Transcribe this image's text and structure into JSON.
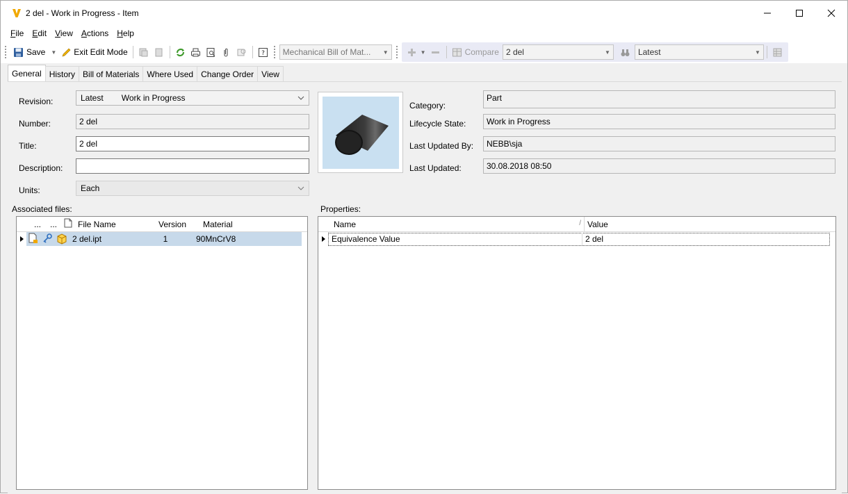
{
  "window": {
    "title": "2 del - Work in Progress - Item"
  },
  "menu": [
    {
      "label_ul": "F",
      "label_rest": "ile"
    },
    {
      "label_ul": "E",
      "label_rest": "dit"
    },
    {
      "label_ul": "V",
      "label_rest": "iew"
    },
    {
      "label_ul": "A",
      "label_rest": "ctions"
    },
    {
      "label_ul": "H",
      "label_rest": "elp"
    }
  ],
  "toolbar": {
    "save_label": "Save",
    "exit_edit_label": "Exit Edit Mode",
    "exit_edit_ul": "x",
    "bom_select": "Mechanical Bill of Mat...",
    "compare_label": "Compare",
    "compare_select": "2 del",
    "latest_select": "Latest"
  },
  "tabs": [
    "General",
    "History",
    "Bill of Materials",
    "Where Used",
    "Change Order",
    "View"
  ],
  "form": {
    "revision_label": "Revision:",
    "revision_value": "Latest",
    "revision_state": "Work in Progress",
    "number_label": "Number:",
    "number_value": "2 del",
    "title_label": "Title:",
    "title_value": "2 del",
    "description_label": "Description:",
    "description_value": "",
    "units_label": "Units:",
    "units_value": "Each"
  },
  "info": {
    "category_label": "Category:",
    "category_value": "Part",
    "lifecycle_label": "Lifecycle State:",
    "lifecycle_value": "Work in Progress",
    "updated_by_label": "Last Updated By:",
    "updated_by_value": "NEBB\\sja",
    "updated_label": "Last Updated:",
    "updated_value": "30.08.2018 08:50"
  },
  "files": {
    "section_label": "Associated files:",
    "col_dots1": "...",
    "col_dots2": "...",
    "col_name": "File Name",
    "col_version": "Version",
    "col_material": "Material",
    "rows": [
      {
        "name": "2 del.ipt",
        "version": "1",
        "material": "90MnCrV8"
      }
    ]
  },
  "properties": {
    "section_label": "Properties:",
    "col_name": "Name",
    "col_value": "Value",
    "rows": [
      {
        "name": "Equivalence Value",
        "value": "2 del"
      }
    ]
  },
  "colors": {
    "accent": "#f0a800",
    "selected_row": "#c7d9ea",
    "thumb_bg": "#c9e0f1"
  }
}
